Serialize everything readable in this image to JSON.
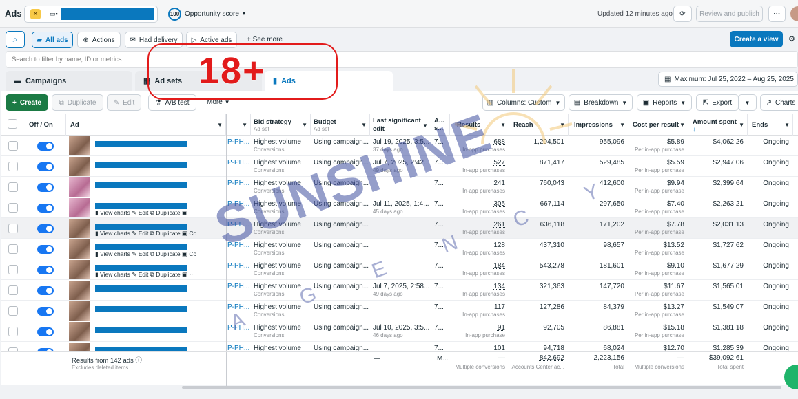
{
  "app": {
    "title": "Ads",
    "score": "100",
    "score_label": "Opportunity score",
    "updated": "Updated 12 minutes ago",
    "review_label": "Review and publish",
    "more": "···"
  },
  "filters": {
    "all_ads": "All ads",
    "actions": "Actions",
    "had_delivery": "Had delivery",
    "active_ads": "Active ads",
    "see_more": "See more",
    "create_view": "Create a view",
    "search_placeholder": "Search to filter by name, ID or metrics"
  },
  "tabs": {
    "campaigns": "Campaigns",
    "adsets": "Ad sets",
    "ads": "Ads",
    "date_range": "Maximum: Jul 25, 2022 – Aug 25, 2025"
  },
  "toolbar": {
    "create": "Create",
    "duplicate": "Duplicate",
    "edit": "Edit",
    "ab_test": "A/B test",
    "more": "More",
    "columns": "Columns: Custom",
    "breakdown": "Breakdown",
    "reports": "Reports",
    "export": "Export",
    "charts": "Charts"
  },
  "columns": {
    "off_on": "Off / On",
    "ad": "Ad",
    "bid": "Bid strategy",
    "bid_sub": "Ad set",
    "budget": "Budget",
    "budget_sub": "Ad set",
    "last_edit": "Last significant edit",
    "a": "A... s...",
    "results": "Results",
    "reach": "Reach",
    "impressions": "Impressions",
    "cpr": "Cost per result",
    "spent": "Amount spent",
    "ends": "Ends"
  },
  "row_actions": {
    "view_charts": "View charts",
    "edit": "Edit",
    "duplicate": "Duplicate",
    "co": "Co"
  },
  "rows": [
    {
      "prefix": "P-PH...",
      "bid": "Highest volume",
      "bid_sub": "Conversions",
      "budget": "Using campaign...",
      "edit": "Jul 19, 2025, 3:5...",
      "edit_sub": "37 days ago",
      "a": "7...",
      "results": "688",
      "results_sub": "In-app purchases",
      "reach": "1,204,501",
      "impr": "955,096",
      "cpr": "$5.89",
      "cpr_sub": "Per in-app purchase",
      "spent": "$4,062.26",
      "ends": "Ongoing"
    },
    {
      "prefix": "P-PH...",
      "bid": "Highest volume",
      "bid_sub": "Conversions",
      "budget": "Using campaign...",
      "edit": "Jul 7, 2025, 2:42...",
      "edit_sub": "49 days ago",
      "a": "7...",
      "results": "527",
      "results_sub": "In-app purchases",
      "reach": "871,417",
      "impr": "529,485",
      "cpr": "$5.59",
      "cpr_sub": "Per in-app purchase",
      "spent": "$2,947.06",
      "ends": "Ongoing"
    },
    {
      "prefix": "P-PH...",
      "bid": "Highest volume",
      "bid_sub": "Conversions",
      "budget": "Using campaign...",
      "edit": "",
      "edit_sub": "",
      "a": "7...",
      "results": "241",
      "results_sub": "In-app purchases",
      "reach": "760,043",
      "impr": "412,600",
      "cpr": "$9.94",
      "cpr_sub": "Per in-app purchase",
      "spent": "$2,399.64",
      "ends": "Ongoing"
    },
    {
      "prefix": "P-PH...",
      "bid": "Highest volume",
      "bid_sub": "Conversions",
      "budget": "Using campaign...",
      "edit": "Jul 11, 2025, 1:4...",
      "edit_sub": "45 days ago",
      "a": "7...",
      "results": "305",
      "results_sub": "In-app purchases",
      "reach": "667,114",
      "impr": "297,650",
      "cpr": "$7.40",
      "cpr_sub": "Per in-app purchase",
      "spent": "$2,263.21",
      "ends": "Ongoing"
    },
    {
      "prefix": "P-PH...",
      "bid": "Highest volume",
      "bid_sub": "Conversions",
      "budget": "Using campaign...",
      "edit": "",
      "edit_sub": "",
      "a": "7...",
      "results": "261",
      "results_sub": "In-app purchases",
      "reach": "636,118",
      "impr": "171,202",
      "cpr": "$7.78",
      "cpr_sub": "Per in-app purchase",
      "spent": "$2,031.13",
      "ends": "Ongoing"
    },
    {
      "prefix": "P-PH...",
      "bid": "Highest volume",
      "bid_sub": "Conversions",
      "budget": "Using campaign...",
      "edit": "",
      "edit_sub": "",
      "a": "7...",
      "results": "128",
      "results_sub": "In-app purchases",
      "reach": "437,310",
      "impr": "98,657",
      "cpr": "$13.52",
      "cpr_sub": "Per in-app purchase",
      "spent": "$1,727.62",
      "ends": "Ongoing"
    },
    {
      "prefix": "P-PH...",
      "bid": "Highest volume",
      "bid_sub": "Conversions",
      "budget": "Using campaign...",
      "edit": "",
      "edit_sub": "",
      "a": "7...",
      "results": "184",
      "results_sub": "In-app purchases",
      "reach": "543,278",
      "impr": "181,601",
      "cpr": "$9.10",
      "cpr_sub": "Per in-app purchase",
      "spent": "$1,677.29",
      "ends": "Ongoing"
    },
    {
      "prefix": "P-PH...",
      "bid": "Highest volume",
      "bid_sub": "Conversions",
      "budget": "Using campaign...",
      "edit": "Jul 7, 2025, 2:58...",
      "edit_sub": "49 days ago",
      "a": "7...",
      "results": "134",
      "results_sub": "In-app purchases",
      "reach": "321,363",
      "impr": "147,720",
      "cpr": "$11.67",
      "cpr_sub": "Per in-app purchase",
      "spent": "$1,565.01",
      "ends": "Ongoing"
    },
    {
      "prefix": "P-PH...",
      "bid": "Highest volume",
      "bid_sub": "Conversions",
      "budget": "Using campaign...",
      "edit": "",
      "edit_sub": "",
      "a": "7...",
      "results": "117",
      "results_sub": "In-app purchases",
      "reach": "127,286",
      "impr": "84,379",
      "cpr": "$13.27",
      "cpr_sub": "Per in-app purchase",
      "spent": "$1,549.07",
      "ends": "Ongoing"
    },
    {
      "prefix": "P-PH...",
      "bid": "Highest volume",
      "bid_sub": "Conversions",
      "budget": "Using campaign...",
      "edit": "Jul 10, 2025, 3:5...",
      "edit_sub": "46 days ago",
      "a": "7...",
      "results": "91",
      "results_sub": "In-app purchase",
      "reach": "92,705",
      "impr": "86,881",
      "cpr": "$15.18",
      "cpr_sub": "Per in-app purchase",
      "spent": "$1,381.18",
      "ends": "Ongoing"
    },
    {
      "prefix": "P-PH...",
      "bid": "Highest volume",
      "bid_sub": "Conversions",
      "budget": "Using campaign...",
      "edit": "",
      "edit_sub": "",
      "a": "7...",
      "results": "101",
      "results_sub": "In-app purchases",
      "reach": "94,718",
      "impr": "68,024",
      "cpr": "$12.70",
      "cpr_sub": "Per in-app purchase",
      "spent": "$1,285.39",
      "ends": "Ongoing"
    }
  ],
  "footer": {
    "results_from": "Results from 142 ads",
    "excludes": "Excludes deleted items",
    "edit_dash": "—",
    "a": "M...",
    "results": "—",
    "results_sub": "Multiple conversions",
    "reach": "842,692",
    "reach_sub": "Accounts Center ac...",
    "impr": "2,223,156",
    "impr_sub": "Total",
    "cpr": "—",
    "cpr_sub": "Multiple conversions",
    "spent": "$39,092.61",
    "spent_sub": "Total spent"
  },
  "overlay": {
    "age_badge": "18+",
    "watermark": "SUNSHINE",
    "watermark_sub": "A G E N C Y"
  },
  "colors": {
    "accent": "#0a78be",
    "create_green": "#1b7a44",
    "toggle": "#1877f2",
    "badge_red": "#e21b1b",
    "watermark": "#3f4fa0"
  }
}
